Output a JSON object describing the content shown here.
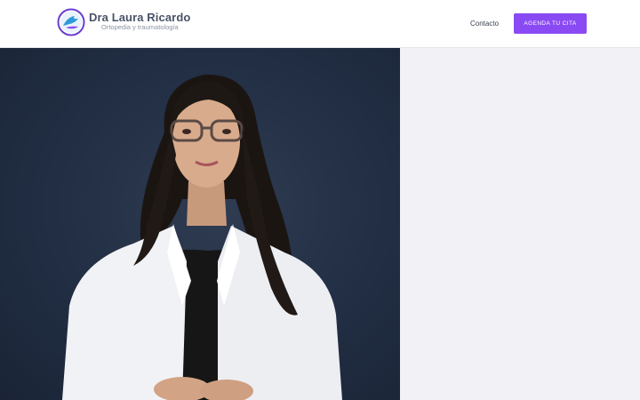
{
  "brand": {
    "name": "Dra Laura Ricardo",
    "tagline": "Ortopedia y traumatología",
    "logo_icon": "dove-circle-logo-icon"
  },
  "nav": {
    "contact_label": "Contacto",
    "cta_label": "AGENDA TU CITA"
  },
  "hero": {
    "image": "portrait-photo-doctor",
    "background_color": "#1f2a3d"
  },
  "colors": {
    "accent": "#8a4af3",
    "panel": "#f2f1f5",
    "brand_text": "#4a5466"
  }
}
